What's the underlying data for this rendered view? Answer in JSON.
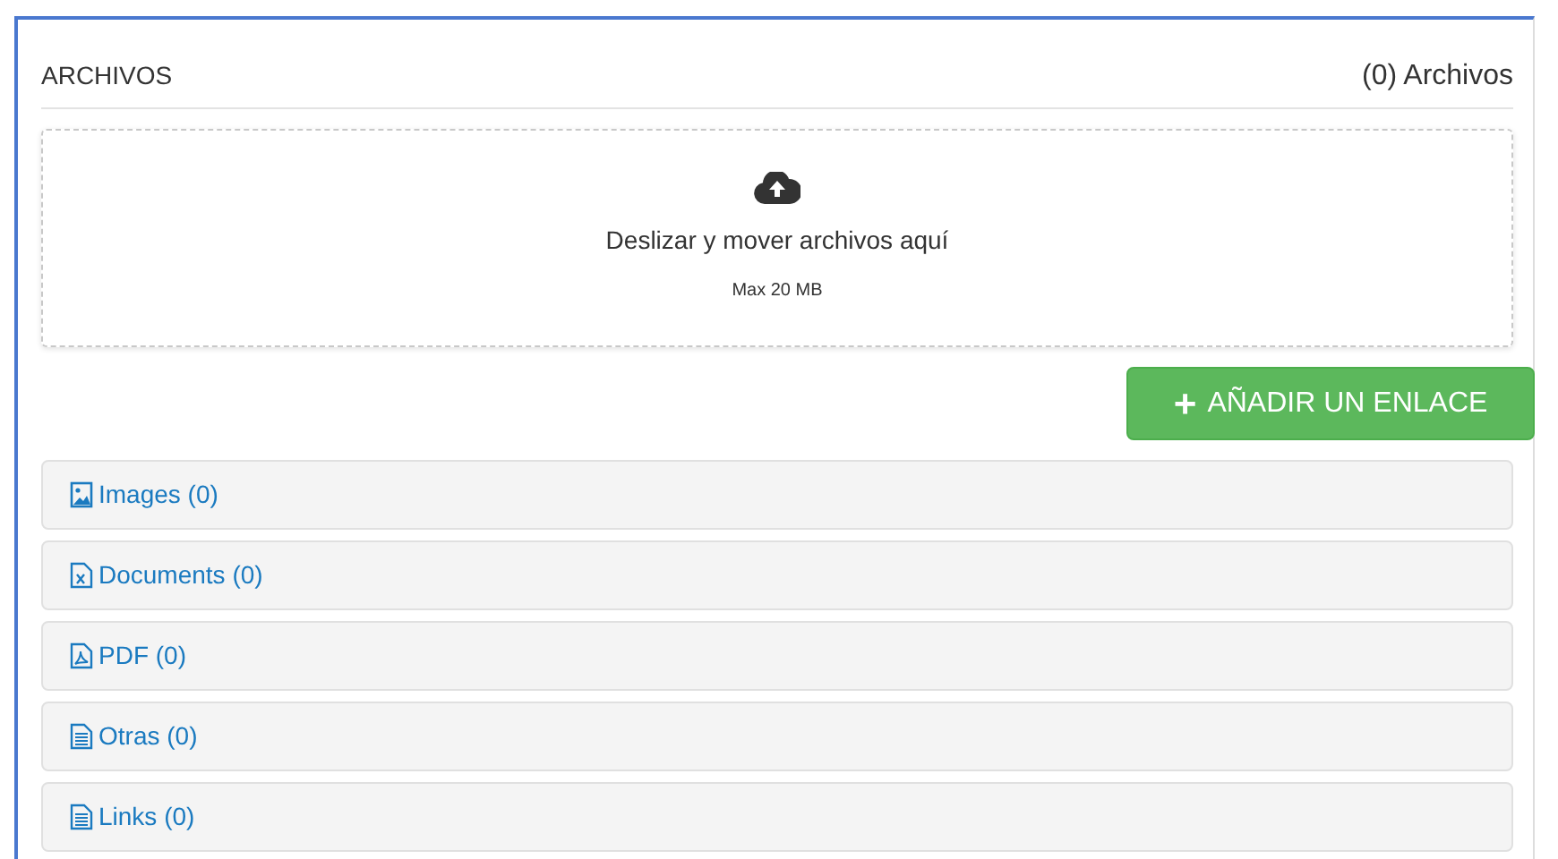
{
  "panel": {
    "title": "ARCHIVOS",
    "count": "(0) Archivos"
  },
  "dropzone": {
    "text": "Deslizar y mover archivos aquí",
    "limit": "Max 20 MB"
  },
  "add_button": {
    "icon": "+",
    "label": "AÑADIR UN ENLACE"
  },
  "groups": [
    {
      "kind": "image",
      "label": "Images (0)"
    },
    {
      "kind": "document",
      "label": "Documents (0)"
    },
    {
      "kind": "pdf",
      "label": "PDF (0)"
    },
    {
      "kind": "text",
      "label": "Otras (0)"
    },
    {
      "kind": "text",
      "label": "Links (0)"
    }
  ]
}
